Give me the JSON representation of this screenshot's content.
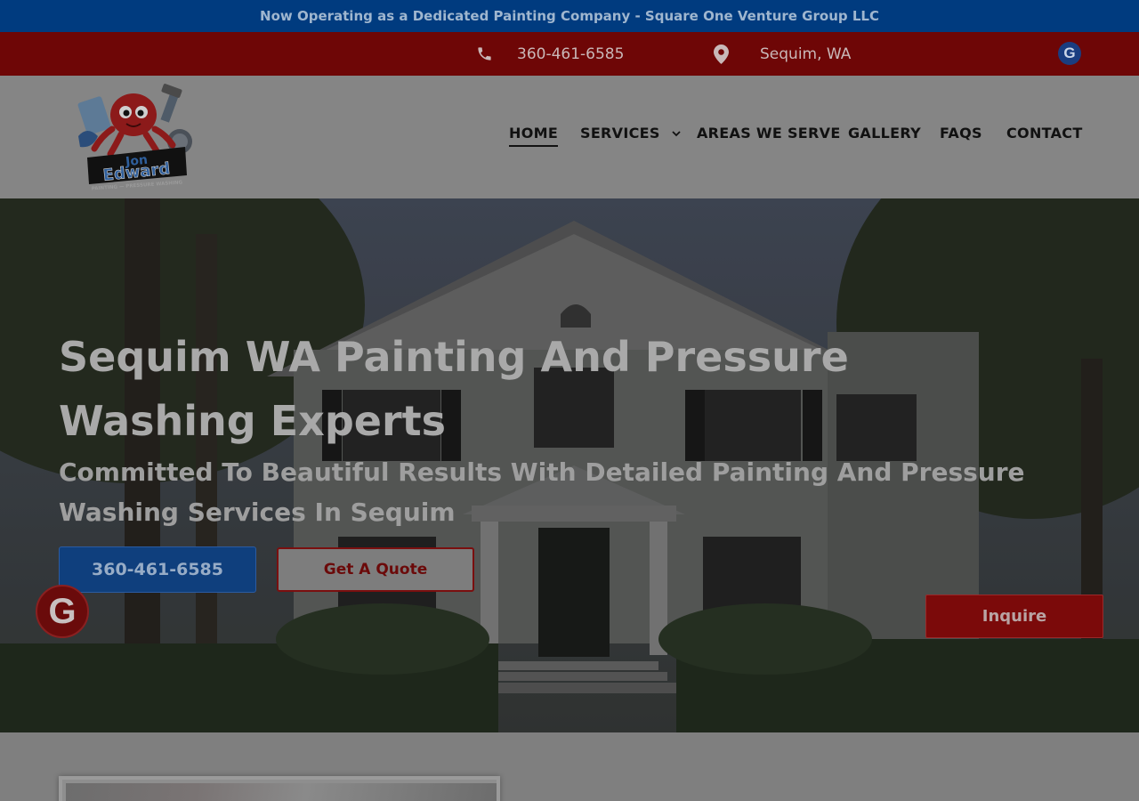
{
  "announcement": {
    "text": "Now Operating as a Dedicated Painting Company - Square One Venture Group LLC"
  },
  "contact_bar": {
    "phone": "360-461-6585",
    "location": "Sequim, WA",
    "phone_icon": "phone-icon",
    "location_icon": "map-pin-icon",
    "google_icon": "google-icon",
    "google_letter": "G"
  },
  "logo": {
    "line1": "Jon",
    "line2": "Edward",
    "tagline": "PAINTING — PRESSURE WASHING"
  },
  "nav": {
    "items": [
      {
        "label": "HOME",
        "active": true
      },
      {
        "label": "SERVICES",
        "has_dropdown": true
      },
      {
        "label": "AREAS WE SERVE"
      },
      {
        "label": "GALLERY"
      },
      {
        "label": "FAQS"
      },
      {
        "label": "CONTACT"
      }
    ],
    "dropdown_icon": "chevron-down-icon"
  },
  "hero": {
    "title": "Sequim WA Painting And Pressure Washing Experts",
    "subtitle": "Committed To Beautiful Results With Detailed Painting And Pressure Washing Services In Sequim",
    "phone_button": "360-461-6585",
    "quote_button": "Get A Quote",
    "inquire_button": "Inquire",
    "google_float_letter": "G"
  },
  "colors": {
    "announce_bg": "#003b7f",
    "contact_bg": "#6e0606",
    "brand_blue": "#0f3f7d",
    "brand_red": "#7b0a0a"
  }
}
